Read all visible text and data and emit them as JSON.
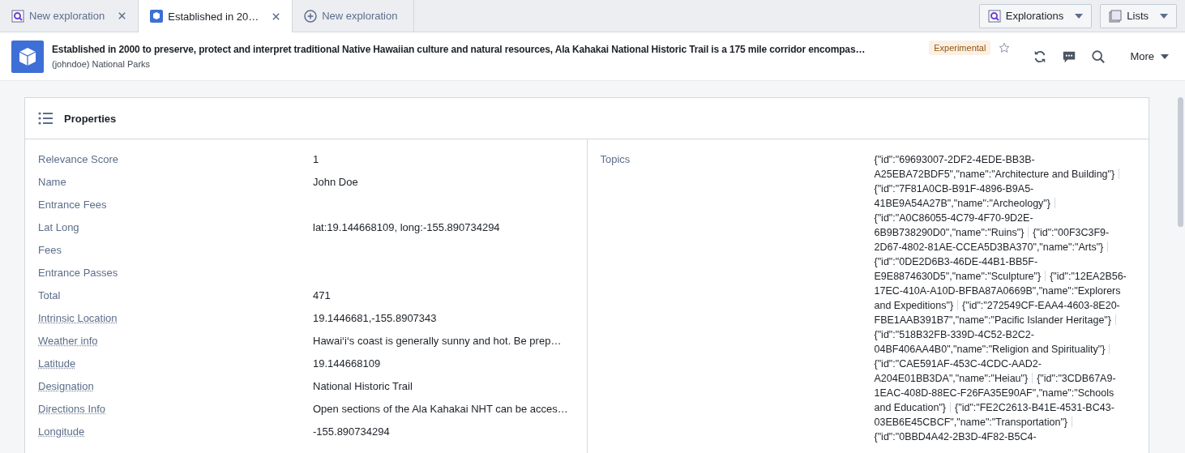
{
  "tabs": [
    {
      "kind": "exploration",
      "label": "New exploration",
      "selected": false
    },
    {
      "kind": "object",
      "label": "Established in 20…",
      "selected": true
    },
    {
      "kind": "new",
      "label": "New exploration",
      "selected": false
    }
  ],
  "tab_actions": [
    {
      "kind": "explorations",
      "label": "Explorations"
    },
    {
      "kind": "lists",
      "label": "Lists"
    }
  ],
  "header": {
    "title": "Established in 2000 to preserve, protect and interpret traditional Native Hawaiian culture and natural resources, Ala Kahakai National Historic Trail is a 175 mile corridor encompas…",
    "subtitle": "(johndoe) National Parks",
    "badge": "Experimental",
    "starred": false,
    "more": "More"
  },
  "panel": {
    "title": "Properties",
    "properties": [
      {
        "label": "Relevance Score",
        "linked": false,
        "value": "1"
      },
      {
        "label": "Name",
        "linked": false,
        "value": "John Doe"
      },
      {
        "label": "Entrance Fees",
        "linked": false
      },
      {
        "label": "Lat Long",
        "linked": false,
        "value": "lat:19.144668109, long:-155.890734294"
      },
      {
        "label": "Fees",
        "linked": false
      },
      {
        "label": "Entrance Passes",
        "linked": false
      },
      {
        "label": "Total",
        "linked": false,
        "value": "471"
      },
      {
        "label": "Intrinsic Location",
        "linked": true,
        "value": "19.1446681,-155.8907343"
      },
      {
        "label": "Weather info",
        "linked": true,
        "value": "Hawai‘i‘s coast is generally sunny and hot. Be prep…"
      },
      {
        "label": "Latitude",
        "linked": true,
        "value": "19.144668109"
      },
      {
        "label": "Designation",
        "linked": true,
        "value": "National Historic Trail"
      },
      {
        "label": "Directions Info",
        "linked": true,
        "value": "Open sections of the Ala Kahakai NHT can be acces…"
      },
      {
        "label": "Longitude",
        "linked": true,
        "value": "-155.890734294"
      }
    ],
    "topics": {
      "label": "Topics",
      "values": [
        "{\"id\":\"69693007-2DF2-4EDE-BB3B-A25EBA72BDF5\",\"name\":\"Architecture and Building\"}",
        "{\"id\":\"7F81A0CB-B91F-4896-B9A5-41BE9A54A27B\",\"name\":\"Archeology\"}",
        "{\"id\":\"A0C86055-4C79-4F70-9D2E-6B9B738290D0\",\"name\":\"Ruins\"}",
        "{\"id\":\"00F3C3F9-2D67-4802-81AE-CCEA5D3BA370\",\"name\":\"Arts\"}",
        "{\"id\":\"0DE2D6B3-46DE-44B1-BB5F-E9E8874630D5\",\"name\":\"Sculpture\"}",
        "{\"id\":\"12EA2B56-17EC-410A-A10D-BFBA87A0669B\",\"name\":\"Explorers and Expeditions\"}",
        "{\"id\":\"272549CF-EAA4-4603-8E20-FBE1AAB391B7\",\"name\":\"Pacific Islander Heritage\"}",
        "{\"id\":\"518B32FB-339D-4C52-B2C2-04BF406AA4B0\",\"name\":\"Religion and Spirituality\"}",
        "{\"id\":\"CAE591AF-453C-4CDC-AAD2-A204E01BB3DA\",\"name\":\"Heiau\"}",
        "{\"id\":\"3CDB67A9-1EAC-408D-88EC-F26FA35E90AF\",\"name\":\"Schools and Education\"}",
        "{\"id\":\"FE2C2613-B41E-4531-BC43-03EB6E45CBCF\",\"name\":\"Transportation\"}",
        "{\"id\":\"0BBD4A42-2B3D-4F82-B5C4-"
      ]
    }
  }
}
